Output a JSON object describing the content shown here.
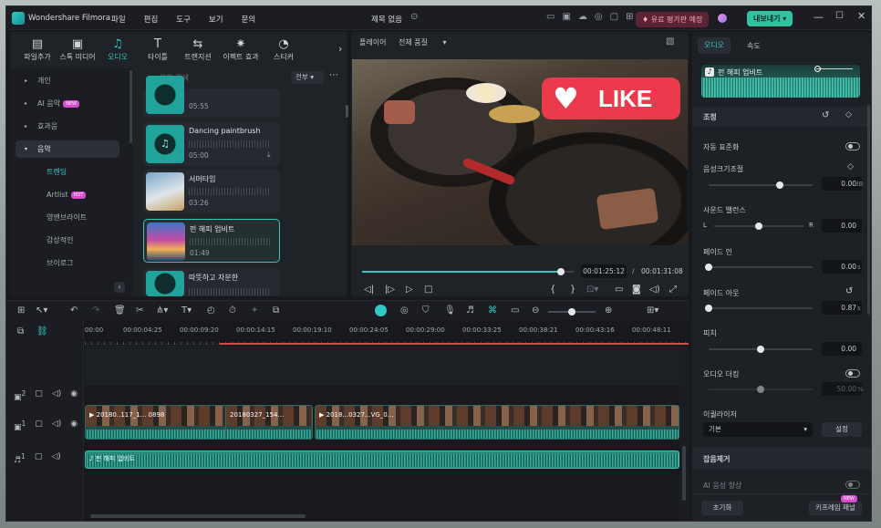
{
  "app": {
    "name": "Wondershare Filmora",
    "project_title": "제목 없음"
  },
  "menu": [
    "파일",
    "편집",
    "도구",
    "보기",
    "문의"
  ],
  "header": {
    "upgrade_label": "유료 평가판 예정",
    "export_label": "내보내기"
  },
  "toolbar": [
    {
      "label": "파일추가",
      "icon": "import-icon"
    },
    {
      "label": "스톡 미디어",
      "icon": "stock-media-icon"
    },
    {
      "label": "오디오",
      "icon": "music-note-icon",
      "active": true
    },
    {
      "label": "타이틀",
      "icon": "title-icon"
    },
    {
      "label": "트랜지션",
      "icon": "transition-icon"
    },
    {
      "label": "이펙트 효과",
      "icon": "effects-icon"
    },
    {
      "label": "스티커",
      "icon": "sticker-icon"
    }
  ],
  "sidebar": {
    "items": [
      {
        "label": "개인"
      },
      {
        "label": "AI 음악",
        "badge": "NEW"
      },
      {
        "label": "효과음"
      },
      {
        "label": "음악",
        "selected": true
      },
      {
        "label": "트렌딩",
        "child": true,
        "active": true
      },
      {
        "label": "Artlist",
        "child": true,
        "badge": "HOT"
      },
      {
        "label": "영앤브라이트",
        "child": true
      },
      {
        "label": "감상적인",
        "child": true
      },
      {
        "label": "브이로그",
        "child": true
      }
    ]
  },
  "library": {
    "search_placeholder": "음악 검색",
    "filter": "전부",
    "tracks": [
      {
        "name": "",
        "duration": "05:55"
      },
      {
        "name": "Dancing paintbrush",
        "duration": "05:00"
      },
      {
        "name": "서머타임",
        "duration": "03:26"
      },
      {
        "name": "펀 해피 업비트",
        "duration": "01:49",
        "selected": true
      },
      {
        "name": "따뜻하고 자분한",
        "duration": ""
      }
    ]
  },
  "player": {
    "label": "플레이어",
    "quality": "전체 품질",
    "overlay_text": "LIKE",
    "current_time": "00:01:25:12",
    "total_time": "00:01:31:08",
    "progress": 0.94
  },
  "inspector": {
    "tabs": [
      "오디오",
      "속도"
    ],
    "clip_name": "펀 해피 업비트",
    "section_adjust": "조정",
    "auto_normalize": "자동 표준화",
    "volume": {
      "label": "음성크기조절",
      "value": "0.00",
      "unit": "dB",
      "level": 0.68
    },
    "balance": {
      "label": "사운드 밸런스",
      "left": "L",
      "right": "R",
      "value": "0.00",
      "level": 0.5
    },
    "fade_in": {
      "label": "페이드 인",
      "value": "0.00",
      "unit": "s",
      "level": 0.0
    },
    "fade_out": {
      "label": "페이드 아웃",
      "value": "0.87",
      "unit": "s",
      "level": 0.0
    },
    "pitch": {
      "label": "피치",
      "value": "0.00",
      "level": 0.5
    },
    "ducking": {
      "label": "오디오 더킹",
      "value": "50.00",
      "unit": "%",
      "level": 0.5
    },
    "equalizer": {
      "label": "이퀄라이저",
      "preset": "기본",
      "settings_label": "설정"
    },
    "denoise": {
      "label": "잡음제거",
      "ai_enhance": "AI 음성 향상"
    },
    "reset_label": "초기화",
    "keyframe_label": "키프레임 패널",
    "keyframe_badge": "NEW"
  },
  "timeline": {
    "ruler": [
      "00:00",
      "00:00:04:25",
      "00:00:09:20",
      "00:00:14:15",
      "00:00:19:10",
      "00:00:24:05",
      "00:00:29:00",
      "00:00:33:25",
      "00:00:38:21",
      "00:00:43:16",
      "00:00:48:11"
    ],
    "tracks": [
      {
        "index": "2",
        "type": "video"
      },
      {
        "index": "1",
        "type": "video"
      },
      {
        "index": "1",
        "type": "audio"
      }
    ],
    "video_clips": [
      "20180..117_1... 0898",
      "20180327_154...",
      "2018...0327...VG_0..."
    ],
    "audio_clip": "펀 해피 업비트",
    "colors": {
      "accent": "#32c8c4",
      "playhead": "#e0e0e0",
      "ruler_red": "#d94b4b"
    }
  }
}
